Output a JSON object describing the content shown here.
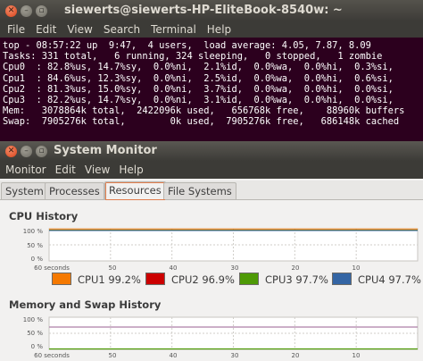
{
  "terminal": {
    "title": "siewerts@siewerts-HP-EliteBook-8540w: ~",
    "menu": [
      "File",
      "Edit",
      "View",
      "Search",
      "Terminal",
      "Help"
    ],
    "lines": [
      "top - 08:57:22 up  9:47,  4 users,  load average: 4.05, 7.87, 8.09",
      "Tasks: 331 total,   6 running, 324 sleeping,   0 stopped,   1 zombie",
      "Cpu0  : 82.8%us, 14.7%sy,  0.0%ni,  2.1%id,  0.0%wa,  0.0%hi,  0.3%si,",
      "Cpu1  : 84.6%us, 12.3%sy,  0.0%ni,  2.5%id,  0.0%wa,  0.0%hi,  0.6%si,",
      "Cpu2  : 81.3%us, 15.0%sy,  0.0%ni,  3.7%id,  0.0%wa,  0.0%hi,  0.0%si,",
      "Cpu3  : 82.2%us, 14.7%sy,  0.0%ni,  3.1%id,  0.0%wa,  0.0%hi,  0.0%si,",
      "Mem:   3078864k total,  2422096k used,   656768k free,    88960k buffers",
      "Swap:  7905276k total,        0k used,  7905276k free,   686148k cached"
    ]
  },
  "sysmon": {
    "title": "System Monitor",
    "menu": [
      "Monitor",
      "Edit",
      "View",
      "Help"
    ],
    "tabs": [
      "System",
      "Processes",
      "Resources",
      "File Systems"
    ],
    "active_tab": "Resources",
    "cpu_history": {
      "title": "CPU History",
      "y_ticks": [
        "100 %",
        "50 %",
        "0 %"
      ],
      "x_ticks": [
        "60 seconds",
        "50",
        "40",
        "30",
        "20",
        "10"
      ],
      "legend": [
        {
          "name": "CPU1",
          "value": "99.2%",
          "color": "#f57900"
        },
        {
          "name": "CPU2",
          "value": "96.9%",
          "color": "#cc0000"
        },
        {
          "name": "CPU3",
          "value": "97.7%",
          "color": "#4e9a06"
        },
        {
          "name": "CPU4",
          "value": "97.7%",
          "color": "#3465a4"
        }
      ]
    },
    "memory_history": {
      "title": "Memory and Swap History",
      "y_ticks": [
        "100 %",
        "50 %",
        "0 %"
      ],
      "x_ticks": [
        "60 seconds",
        "50",
        "40",
        "30",
        "20",
        "10"
      ]
    }
  }
}
